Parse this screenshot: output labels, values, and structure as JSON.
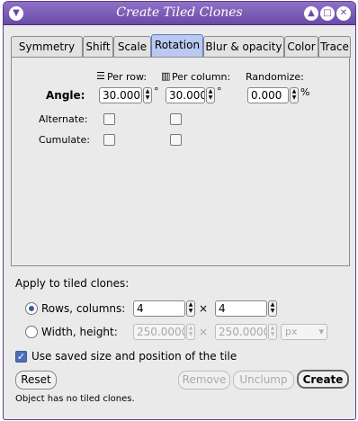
{
  "window": {
    "title": "Create Tiled Clones"
  },
  "tabs": [
    {
      "label": "Symmetry"
    },
    {
      "label": "Shift"
    },
    {
      "label": "Scale"
    },
    {
      "label": "Rotation"
    },
    {
      "label": "Blur & opacity"
    },
    {
      "label": "Color"
    },
    {
      "label": "Trace"
    }
  ],
  "rotation": {
    "per_row_label": "Per row:",
    "per_column_label": "Per column:",
    "randomize_label": "Randomize:",
    "angle_label": "Angle:",
    "per_row_value": "30.000",
    "per_column_value": "30.000",
    "randomize_value": "0.000",
    "degree_symbol": "°",
    "percent_symbol": "%",
    "alternate_label": "Alternate:",
    "cumulate_label": "Cumulate:"
  },
  "apply": {
    "section_label": "Apply to tiled clones:",
    "rows_columns_label": "Rows, columns:",
    "rows_value": "4",
    "columns_value": "4",
    "times_symbol": "×",
    "width_height_label": "Width, height:",
    "width_value": "250.0000",
    "height_value": "250.0000",
    "unit_value": "px",
    "use_saved_label": "Use saved size and position of the tile"
  },
  "buttons": {
    "reset": "Reset",
    "remove": "Remove",
    "unclump": "Unclump",
    "create": "Create"
  },
  "status": "Object has no tiled clones."
}
